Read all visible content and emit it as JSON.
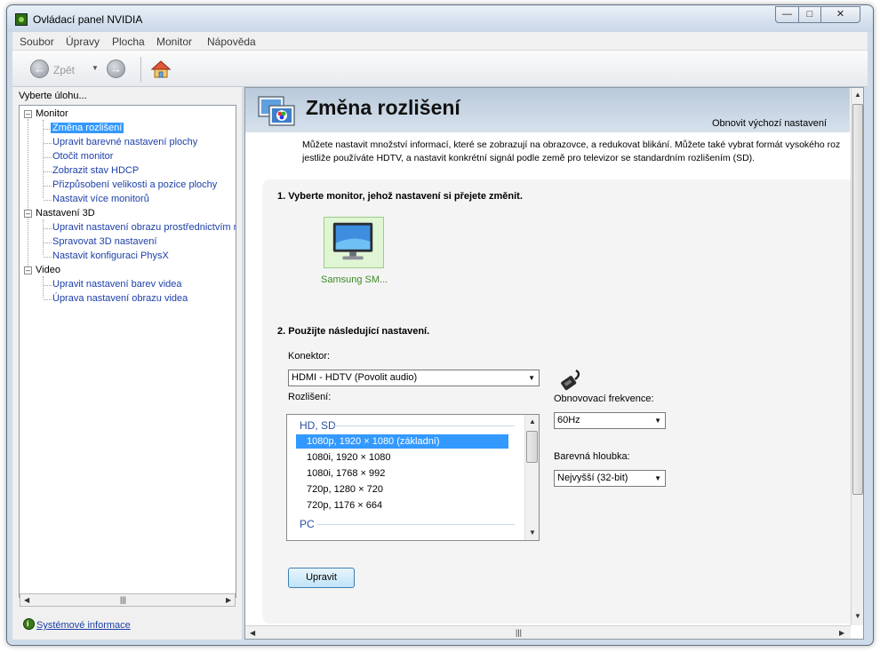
{
  "window": {
    "title": "Ovládací panel NVIDIA"
  },
  "menu": [
    "Soubor",
    "Úpravy",
    "Plocha",
    "Monitor",
    "Nápověda"
  ],
  "toolbar": {
    "back_label": "Zpět"
  },
  "sidebar": {
    "task_label": "Vyberte úlohu...",
    "groups": [
      {
        "label": "Monitor",
        "items": [
          "Změna rozlišení",
          "Upravit barevné nastavení plochy",
          "Otočit monitor",
          "Zobrazit stav HDCP",
          "Přizpůsobení velikosti a pozice plochy",
          "Nastavit více monitorů"
        ]
      },
      {
        "label": "Nastavení 3D",
        "items": [
          "Upravit nastavení obrazu prostřednictvím n",
          "Spravovat 3D nastavení",
          "Nastavit konfiguraci PhysX"
        ]
      },
      {
        "label": "Video",
        "items": [
          "Upravit nastavení barev videa",
          "Úprava nastavení obrazu videa"
        ]
      }
    ],
    "selected_item": "Změna rozlišení",
    "system_info": "Systémové informace"
  },
  "main": {
    "title": "Změna rozlišení",
    "restore_defaults": "Obnovit výchozí nastavení",
    "description": [
      "Můžete nastavit množství informací, které se zobrazují na obrazovce, a redukovat blikání. Můžete také vybrat formát vysokého roz",
      "jestliže používáte HDTV, a nastavit konkrétní signál podle země pro televizor se standardním rozlišením (SD)."
    ],
    "step1": "1. Vyberte monitor, jehož nastavení si přejete změnit.",
    "monitor_name": "Samsung SM...",
    "step2": "2. Použijte následující nastavení.",
    "connector_label": "Konektor:",
    "connector_value": "HDMI - HDTV (Povolit audio)",
    "resolution_label": "Rozlišení:",
    "resolution_groups": [
      {
        "name": "HD, SD",
        "items": [
          "1080p, 1920 × 1080 (základní)",
          "1080i, 1920 × 1080",
          "1080i, 1768 × 992",
          "720p, 1280 × 720",
          "720p, 1176 × 664"
        ]
      },
      {
        "name": "PC",
        "items": []
      }
    ],
    "selected_resolution": "1080p, 1920 × 1080 (základní)",
    "refresh_label": "Obnovovací frekvence:",
    "refresh_value": "60Hz",
    "depth_label": "Barevná hloubka:",
    "depth_value": "Nejvyšší (32-bit)",
    "apply_label": "Upravit"
  },
  "colors": {
    "selection": "#3399ff",
    "link": "#1c3fa8",
    "header_band": "#b9c9db",
    "monitor_label": "#3b8a26"
  }
}
